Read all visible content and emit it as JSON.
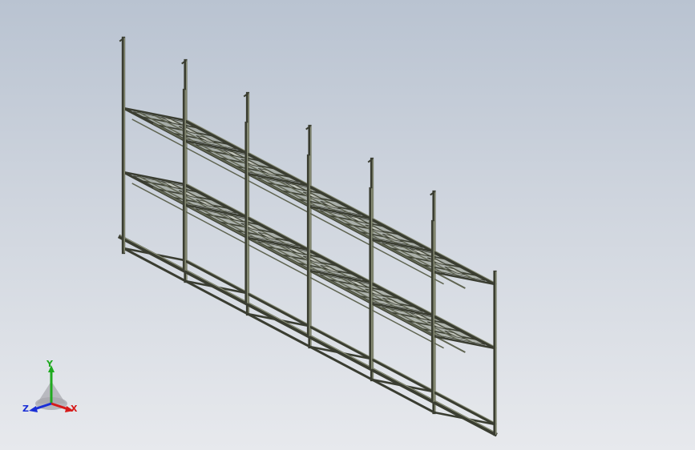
{
  "viewport": {
    "background_top": "#b9c3d1",
    "background_bottom": "#e7e9ed",
    "model": {
      "description_icon": "steel-rack-assembly",
      "frame_color": "#5f6451",
      "frame_dark_color": "#3a3d31",
      "frame_light_color": "#8a8f78",
      "shelf_levels": 3,
      "bays": 5
    },
    "triad": {
      "x_label": "X",
      "y_label": "Y",
      "z_label": "Z",
      "x_color": "#d61a1a",
      "y_color": "#1faa1f",
      "z_color": "#1a2fd6"
    }
  }
}
